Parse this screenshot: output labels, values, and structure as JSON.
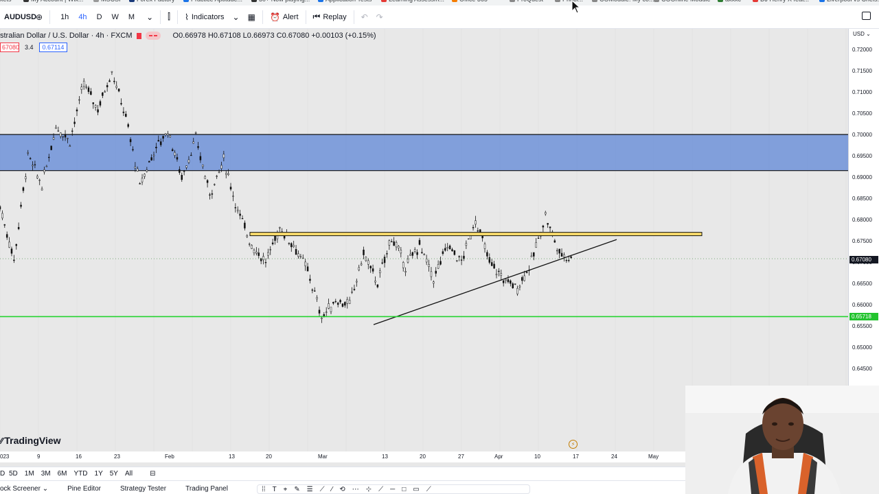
{
  "bookmarks": [
    {
      "label": "kets",
      "color": "#888888"
    },
    {
      "label": "My Account | Wix...",
      "color": "#333333"
    },
    {
      "label": "MSCSI",
      "color": "#999999"
    },
    {
      "label": "Forex Factory",
      "color": "#1a3a7a"
    },
    {
      "label": "Practice Aptitude...",
      "color": "#1a73e8"
    },
    {
      "label": "30+ Now playing...",
      "color": "#333333"
    },
    {
      "label": "Application Tests",
      "color": "#1a73e8"
    },
    {
      "label": "Learning Assessm...",
      "color": "#e53935"
    },
    {
      "label": "Office 365",
      "color": "#f57c00"
    },
    {
      "label": "ProQuest",
      "color": "#888888"
    },
    {
      "label": "Princi...",
      "color": "#888888"
    },
    {
      "label": "COModule: My co...",
      "color": "#888888"
    },
    {
      "label": "COOnline Module",
      "color": "#888888"
    },
    {
      "label": "axxxc",
      "color": "#2e7d32"
    },
    {
      "label": "DJ Henry X feat...",
      "color": "#e53935"
    },
    {
      "label": "Liverpool vs Chels...",
      "color": "#1a73e8"
    }
  ],
  "toolbar": {
    "symbol": "AUDUSD",
    "add_icon": "⊕",
    "intervals": [
      "1h",
      "4h",
      "D",
      "W",
      "M"
    ],
    "active_interval": "4h",
    "chevron": "⌄",
    "chart_type_icon": "⫿",
    "indicators_label": "Indicators",
    "indicators_icon": "⌇",
    "templates_icon": "▦",
    "alert_label": "Alert",
    "alert_icon": "⏰",
    "replay_label": "Replay",
    "replay_icon": "⏮",
    "undo_icon": "↶",
    "redo_icon": "↷"
  },
  "legend": {
    "title": "stralian Dollar / U.S. Dollar · 4h · FXCM",
    "ohlc": "O0.66978  H0.67108  L0.66973  C0.67080  +0.00103 (+0.15%)",
    "bid": "67080",
    "spread": "3.4",
    "ask": "0.67114"
  },
  "price_axis": {
    "currency": "USD ⌄",
    "ticks": [
      "0.72000",
      "0.71500",
      "0.71000",
      "0.70500",
      "0.70000",
      "0.69500",
      "0.69000",
      "0.68500",
      "0.68000",
      "0.67500",
      "0.67000",
      "0.66500",
      "0.66000",
      "0.65500",
      "0.65000",
      "0.64500"
    ],
    "current_price": "0.67080",
    "current_color": "#131722",
    "support_price": "0.65718",
    "support_color": "#22c32e"
  },
  "time_axis": {
    "labels": [
      "023",
      "9",
      "16",
      "23",
      "Feb",
      "13",
      "20",
      "Mar",
      "13",
      "20",
      "27",
      "Apr",
      "10",
      "17",
      "24",
      "May"
    ]
  },
  "branding": {
    "logo_mark": "⁄⁄",
    "logo_text": "TradingView"
  },
  "bolt_icon": "⚡",
  "range_bar": {
    "ranges": [
      "D",
      "5D",
      "1M",
      "3M",
      "6M",
      "YTD",
      "1Y",
      "5Y",
      "All"
    ],
    "calendar_icon": "⊟"
  },
  "bottom_tabs": [
    "ock Screener  ⌄",
    "Pine Editor",
    "Strategy Tester",
    "Trading Panel"
  ],
  "draw_tools": [
    "⁞⁞",
    "T",
    "⌖",
    "✎",
    "☰",
    "⟋",
    "⁄",
    "⟲",
    "⋯",
    "⊹",
    "⟋",
    "─",
    "□",
    "▭",
    "⟋"
  ],
  "chart_data": {
    "type": "candlestick",
    "symbol": "AUDUSD",
    "timeframe": "4h",
    "ylim": [
      0.6425,
      0.7225
    ],
    "zones": [
      {
        "kind": "resistance-zone",
        "top": 0.7,
        "bottom": 0.6915,
        "color": "#6f92d8"
      },
      {
        "kind": "resistance-line",
        "top": 0.677,
        "bottom": 0.6762,
        "color": "#f7d96b"
      }
    ],
    "support_level": 0.65718,
    "trendline": {
      "from_price": 0.6553,
      "to_price": 0.6753
    },
    "swing_path": [
      [
        0.683
      ],
      [
        0.6705
      ],
      [
        0.695
      ],
      [
        0.688
      ],
      [
        0.702
      ],
      [
        0.6985
      ],
      [
        0.712
      ],
      [
        0.706
      ],
      [
        0.715
      ],
      [
        0.704
      ],
      [
        0.688
      ],
      [
        0.696
      ],
      [
        0.701
      ],
      [
        0.69
      ],
      [
        0.699
      ],
      [
        0.686
      ],
      [
        0.694
      ],
      [
        0.682
      ],
      [
        0.674
      ],
      [
        0.67
      ],
      [
        0.678
      ],
      [
        0.674
      ],
      [
        0.668
      ],
      [
        0.657
      ],
      [
        0.661
      ],
      [
        0.66
      ],
      [
        0.672
      ],
      [
        0.665
      ],
      [
        0.676
      ],
      [
        0.669
      ],
      [
        0.674
      ],
      [
        0.666
      ],
      [
        0.674
      ],
      [
        0.67
      ],
      [
        0.68
      ],
      [
        0.67
      ],
      [
        0.666
      ],
      [
        0.664
      ],
      [
        0.67
      ],
      [
        0.681
      ],
      [
        0.672
      ],
      [
        0.6708
      ]
    ]
  }
}
